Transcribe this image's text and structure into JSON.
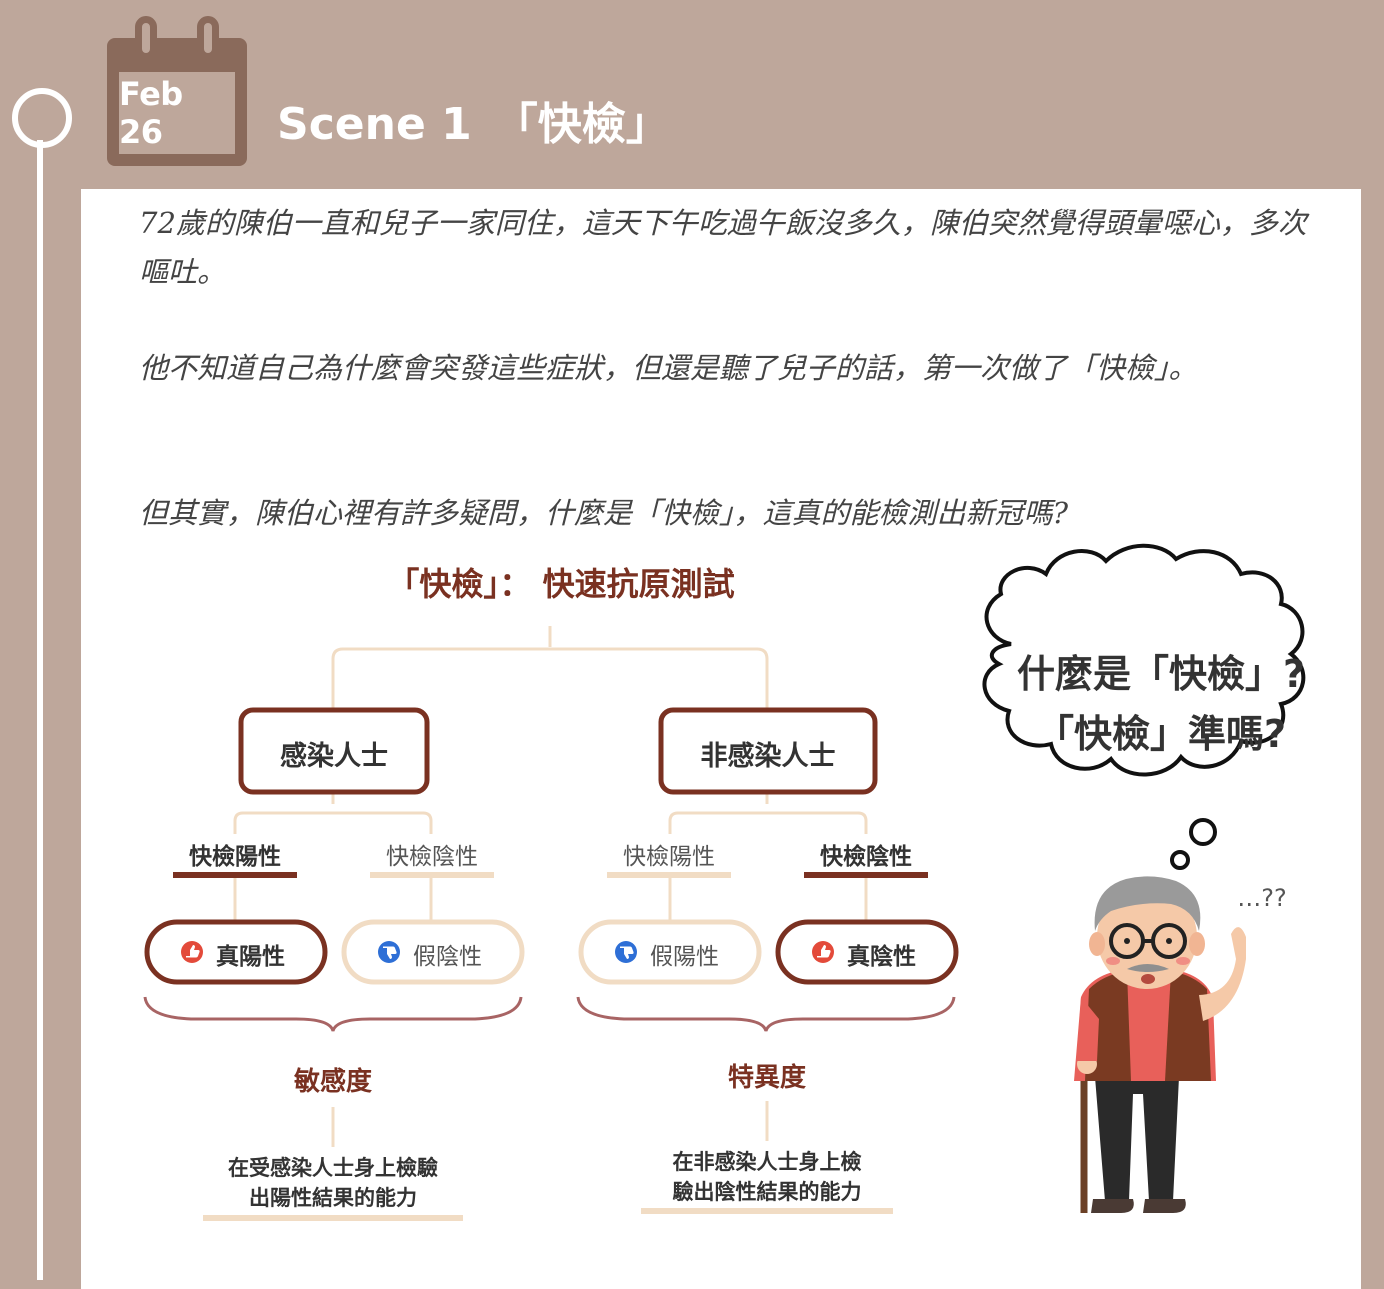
{
  "header": {
    "date": "Feb 26",
    "title": "Scene 1　「快檢」"
  },
  "story": {
    "p1": "72歲的陳伯一直和兒子一家同住，這天下午吃過午飯沒多久，陳伯突然覺得頭暈噁心，多次嘔吐。",
    "p2": "他不知道自己為什麼會突發這些症狀，但還是聽了兒子的話，第一次做了「快檢」。",
    "p3": "但其實，陳伯心裡有許多疑問，什麼是「快檢」，這真的能檢測出新冠嗎?"
  },
  "diagram": {
    "title": "「快檢」： 快速抗原測試",
    "infected": "感染人士",
    "non_infected": "非感染人士",
    "pos1": "快檢陽性",
    "neg1": "快檢陰性",
    "pos2": "快檢陽性",
    "neg2": "快檢陰性",
    "true_pos": "真陽性",
    "false_neg": "假陰性",
    "false_pos": "假陽性",
    "true_neg": "真陰性",
    "sensitivity": "敏感度",
    "specificity": "特異度",
    "sens_desc_1": "在受感染人士身上檢驗",
    "sens_desc_2": "出陽性結果的能力",
    "spec_desc_1": "在非感染人士身上檢",
    "spec_desc_2": "驗出陰性結果的能力",
    "colors": {
      "dark": "#7a3121",
      "light": "#f1dcc4",
      "red_icon": "#e34a3a",
      "blue_icon": "#2e6fd6"
    }
  },
  "thought": {
    "line1": "什麼是「快檢」?",
    "line2": "「快檢」準嗎?",
    "murmur": "…??"
  }
}
